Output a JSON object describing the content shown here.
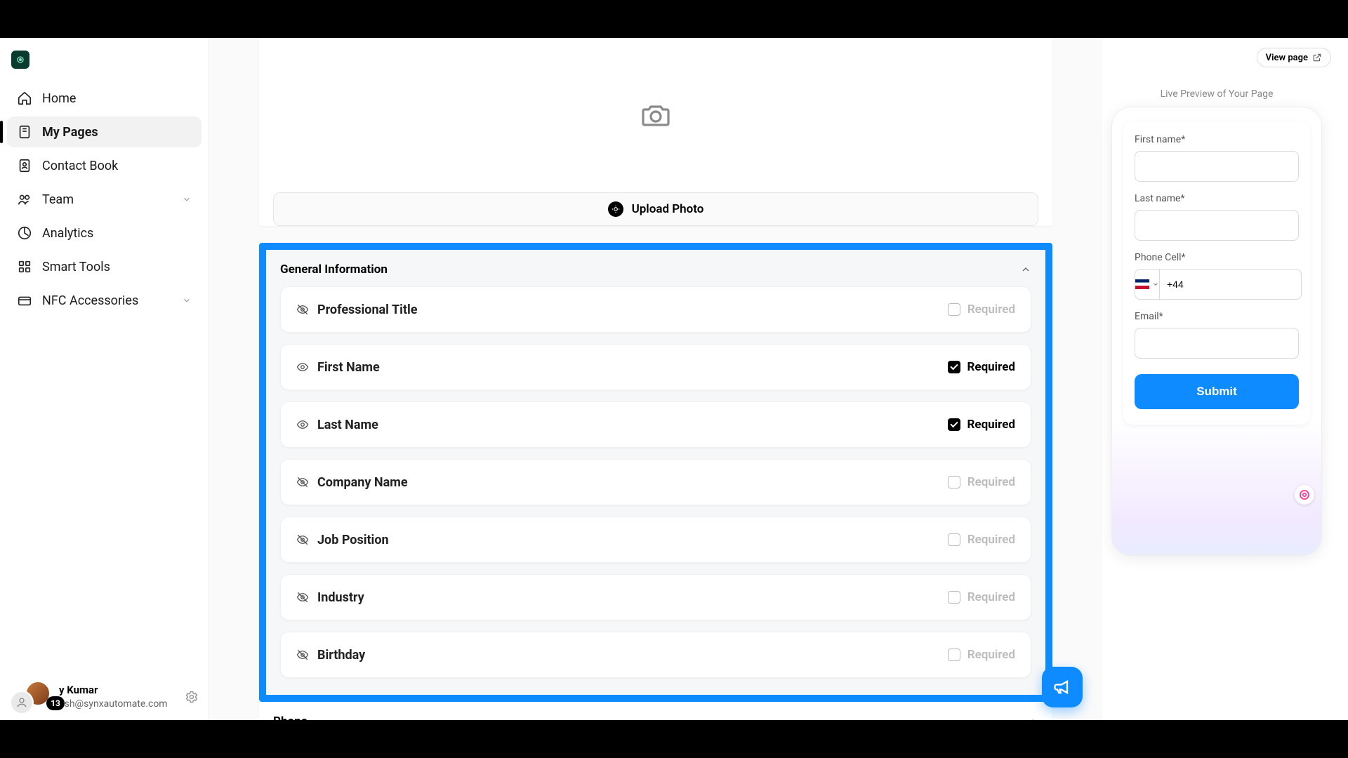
{
  "sidebar": {
    "items": [
      {
        "label": "Home"
      },
      {
        "label": "My Pages",
        "active": true
      },
      {
        "label": "Contact Book"
      },
      {
        "label": "Team",
        "expandable": true
      },
      {
        "label": "Analytics"
      },
      {
        "label": "Smart Tools"
      },
      {
        "label": "NFC Accessories",
        "expandable": true
      }
    ],
    "badge_count": "13",
    "user_name_visible": "y Kumar",
    "user_email": "ash@synxautomate.com"
  },
  "editor": {
    "upload_label": "Upload Photo",
    "sections": {
      "general": {
        "title": "General Information",
        "fields": [
          {
            "label": "Professional Title",
            "required": false,
            "visible": false
          },
          {
            "label": "First Name",
            "required": true,
            "visible": true
          },
          {
            "label": "Last Name",
            "required": true,
            "visible": true
          },
          {
            "label": "Company Name",
            "required": false,
            "visible": false
          },
          {
            "label": "Job Position",
            "required": false,
            "visible": false
          },
          {
            "label": "Industry",
            "required": false,
            "visible": false
          },
          {
            "label": "Birthday",
            "required": false,
            "visible": false
          }
        ],
        "required_label": "Required"
      },
      "phone": {
        "title": "Phone"
      }
    }
  },
  "preview": {
    "view_page_label": "View page",
    "caption": "Live Preview of Your Page",
    "first_name_label": "First name*",
    "last_name_label": "Last name*",
    "phone_label": "Phone Cell*",
    "phone_prefix": "+44",
    "email_label": "Email*",
    "submit_label": "Submit"
  }
}
